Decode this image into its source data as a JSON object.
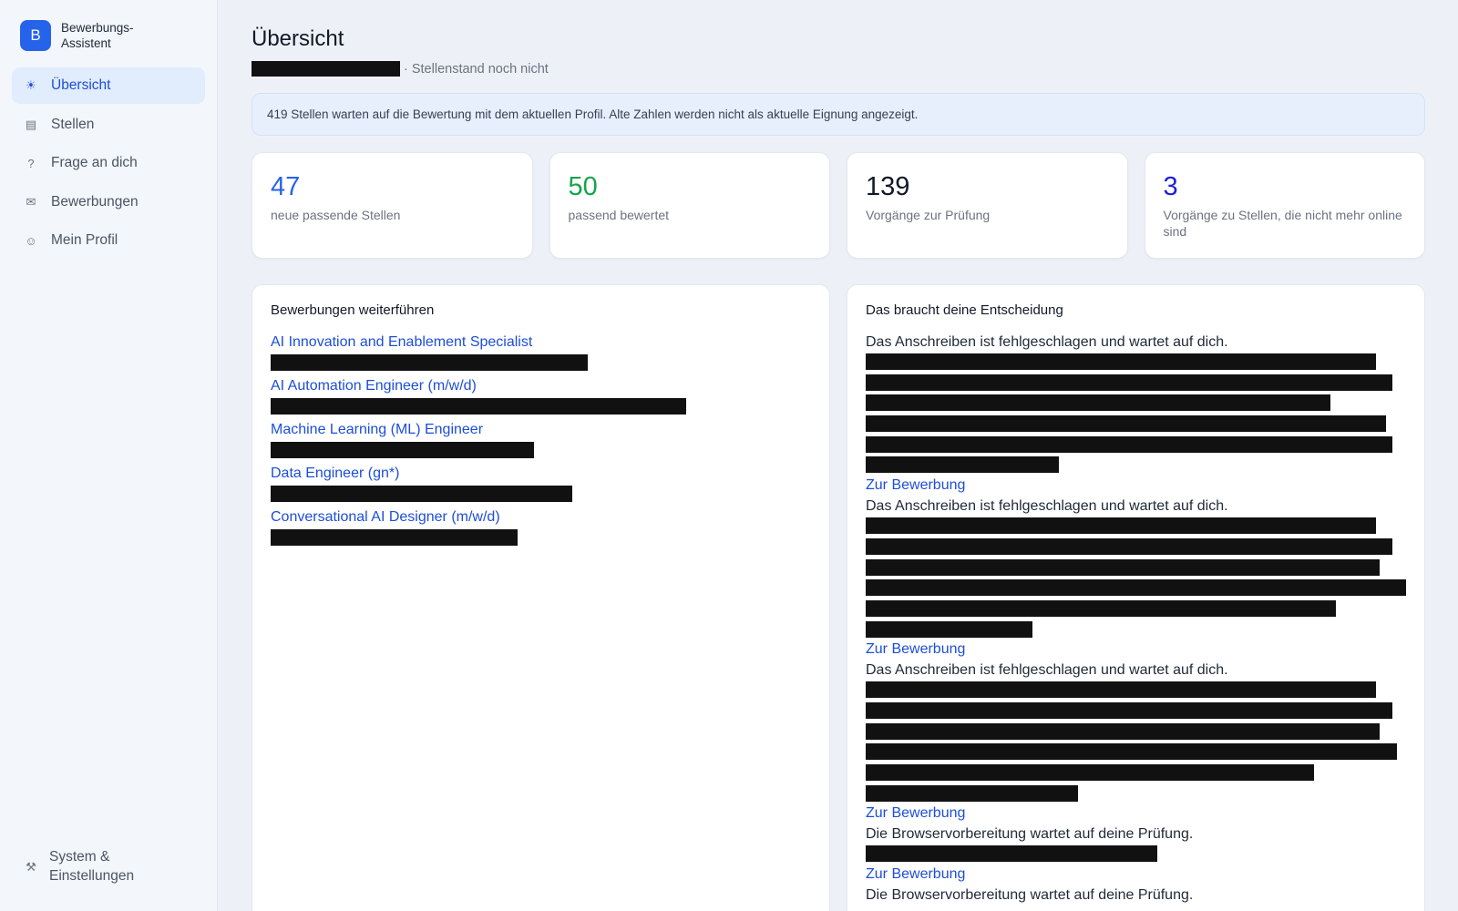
{
  "app": {
    "logo_letter": "B",
    "name": "Bewerbungs-Assistent"
  },
  "sidebar": {
    "items": [
      {
        "label": "Übersicht",
        "icon": "sun-icon",
        "glyph": "☀"
      },
      {
        "label": "Stellen",
        "icon": "list-icon",
        "glyph": "▤"
      },
      {
        "label": "Frage an dich",
        "icon": "question-icon",
        "glyph": "?"
      },
      {
        "label": "Bewerbungen",
        "icon": "mail-icon",
        "glyph": "✉"
      },
      {
        "label": "Mein Profil",
        "icon": "smiley-icon",
        "glyph": "☺"
      }
    ],
    "system_label": "System & Einstellungen",
    "system_icon": "tools-icon"
  },
  "header": {
    "title": "Übersicht",
    "subtitle_suffix": "· Stellenstand noch nicht"
  },
  "info_banner": "419 Stellen warten auf die Bewertung mit dem aktuellen Profil. Alte Zahlen werden nicht als aktuelle Eignung angezeigt.",
  "stats": [
    {
      "value": "47",
      "label": "neue passende Stellen",
      "color": "#2563eb"
    },
    {
      "value": "50",
      "label": "passend bewertet",
      "color": "#16a34a"
    },
    {
      "value": "139",
      "label": "Vorgänge zur Prüfung",
      "color": "#111827"
    },
    {
      "value": "3",
      "label": "Vorgänge zu Stellen, die nicht mehr online sind",
      "color": "#1d1de0"
    }
  ],
  "continue_panel": {
    "title": "Bewerbungen weiterführen",
    "jobs": [
      {
        "title": "AI Innovation and Enablement Specialist"
      },
      {
        "title": "AI Automation Engineer (m/w/d)"
      },
      {
        "title": "Machine Learning (ML) Engineer"
      },
      {
        "title": "Data Engineer (gn*)"
      },
      {
        "title": "Conversational AI Designer (m/w/d)"
      }
    ]
  },
  "decision_panel": {
    "title": "Das braucht deine Entscheidung",
    "items": [
      {
        "text": "Das Anschreiben ist fehlgeschlagen und wartet auf dich.",
        "link": "Zur Bewerbung"
      },
      {
        "text": "Das Anschreiben ist fehlgeschlagen und wartet auf dich.",
        "link": "Zur Bewerbung"
      },
      {
        "text": "Das Anschreiben ist fehlgeschlagen und wartet auf dich.",
        "link": "Zur Bewerbung"
      },
      {
        "text": "Die Browservorbereitung wartet auf deine Prüfung.",
        "link": "Zur Bewerbung"
      },
      {
        "text": "Die Browservorbereitung wartet auf deine Prüfung.",
        "link": ""
      }
    ]
  }
}
